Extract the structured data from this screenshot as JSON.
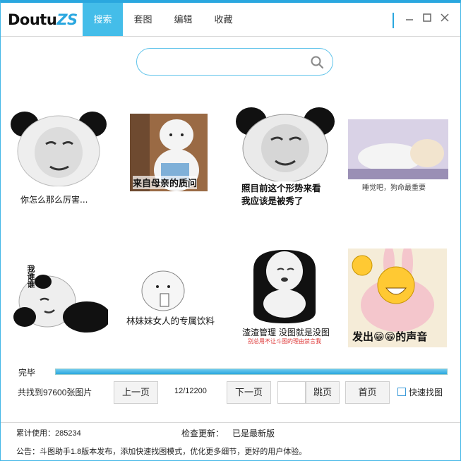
{
  "app": {
    "logo_main": "Doutu",
    "logo_accent": "ZS",
    "accent_color": "#2aa7df"
  },
  "tabs": [
    {
      "label": "搜索",
      "active": true
    },
    {
      "label": "套图",
      "active": false
    },
    {
      "label": "编辑",
      "active": false
    },
    {
      "label": "收藏",
      "active": false
    }
  ],
  "window_controls": [
    "minimize-icon",
    "maximize-icon",
    "close-icon"
  ],
  "search": {
    "value": "",
    "placeholder": ""
  },
  "memes": [
    {
      "caption": "你怎么那么厉害..."
    },
    {
      "caption": "来自母亲的质问"
    },
    {
      "caption_line1": "照目前这个形势来看",
      "caption_line2": "我应该是被秀了"
    },
    {
      "caption": "睡觉吧，狗命最重要"
    },
    {
      "caption": "我谁谁"
    },
    {
      "caption": "林妹妹女人的专属饮料"
    },
    {
      "caption": "渣渣管理 没图就是没图",
      "subcaption": "别总用不让斗图的理由禁言我"
    },
    {
      "caption": "发出😁😁的声音"
    }
  ],
  "status": {
    "label": "完毕",
    "progress": 1.0
  },
  "pagination": {
    "found_text": "共找到97600张图片",
    "prev_label": "上一页",
    "page_info": "12/12200",
    "next_label": "下一页",
    "jump_value": "",
    "jump_label": "跳页",
    "home_label": "首页",
    "quick_label": "快速找图",
    "quick_checked": false
  },
  "footer": {
    "usage_text": "累计使用：285234",
    "update_label": "检查更新：",
    "update_status": "已是最新版",
    "notice_text": "公告：斗图助手1.8版本发布，添加快速找图模式，优化更多细节，更好的用户体验。"
  }
}
